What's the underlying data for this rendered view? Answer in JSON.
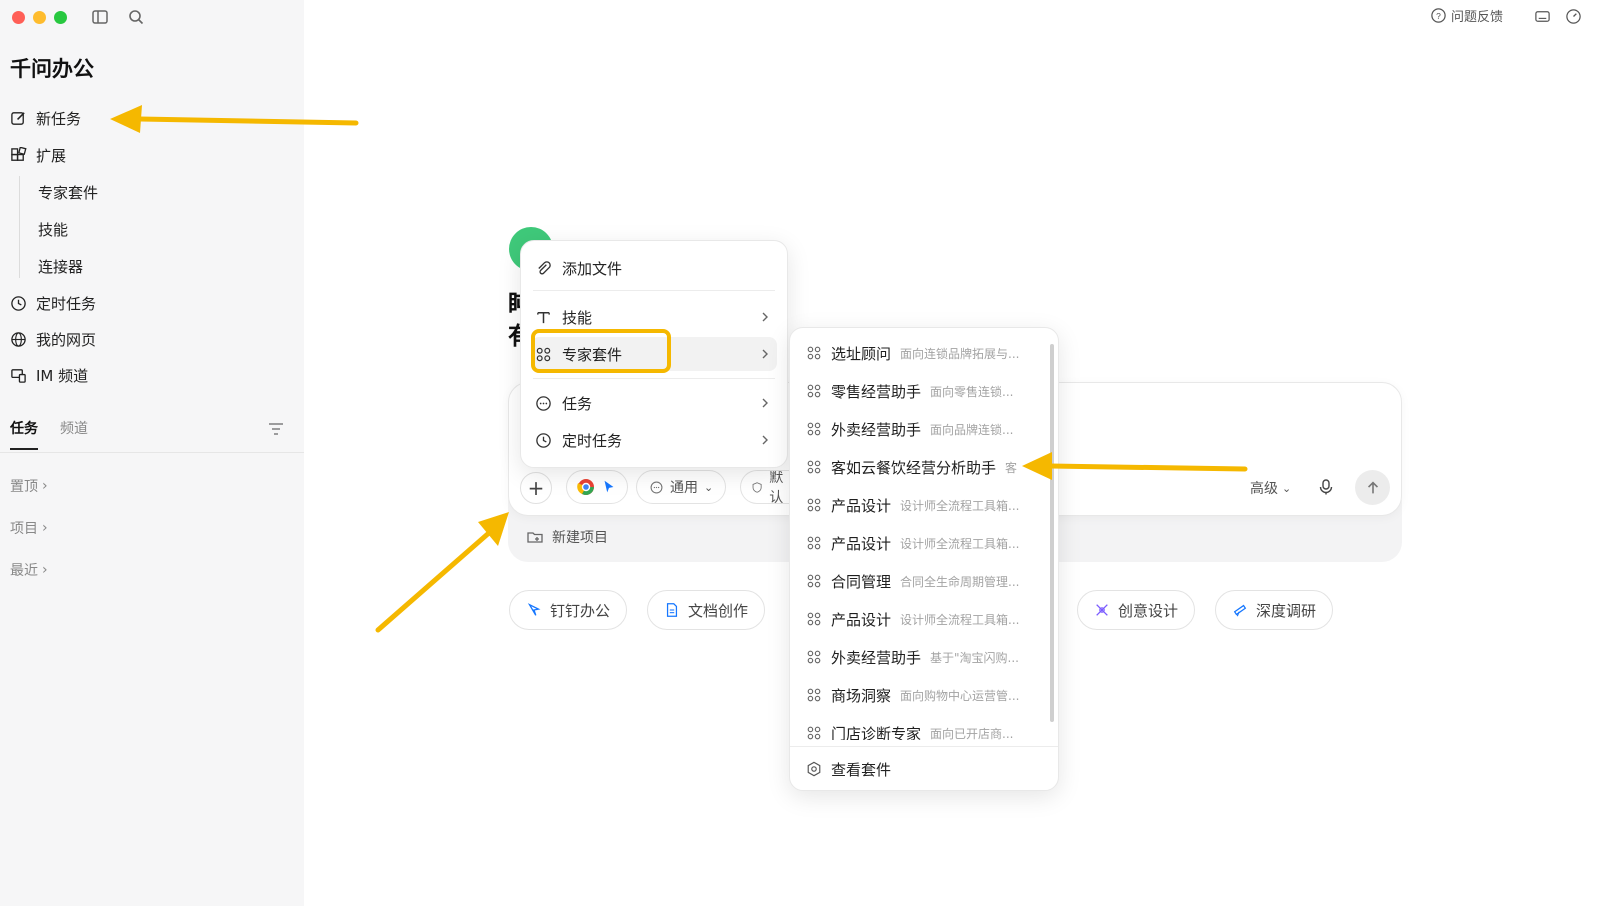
{
  "app": {
    "title": "千问办公"
  },
  "sidebar": {
    "new_task": "新任务",
    "extensions": "扩展",
    "ext_children": [
      "专家套件",
      "技能",
      "连接器"
    ],
    "scheduled": "定时任务",
    "webpages": "我的网页",
    "im_channel": "IM 频道",
    "tabs": [
      "任务",
      "频道"
    ],
    "groups": [
      "置顶",
      "项目",
      "最近"
    ]
  },
  "topbar": {
    "feedback": "问题反馈"
  },
  "composer": {
    "greeting_partial": [
      "盹",
      "有"
    ],
    "mode_general": "通用",
    "default_partial": "默认",
    "advanced": "高级",
    "new_project": "新建项目"
  },
  "chips": {
    "dingtalk": "钉钉办公",
    "doc": "文档创作",
    "creative": "创意设计",
    "research": "深度调研"
  },
  "menu_main": {
    "add_file": "添加文件",
    "skills": "技能",
    "expert_kit": "专家套件",
    "tasks": "任务",
    "scheduled": "定时任务"
  },
  "menu_kits": {
    "items": [
      {
        "name": "选址顾问",
        "desc": "面向连锁品牌拓展与..."
      },
      {
        "name": "零售经营助手",
        "desc": "面向零售连锁..."
      },
      {
        "name": "外卖经营助手",
        "desc": "面向品牌连锁..."
      },
      {
        "name": "客如云餐饮经营分析助手",
        "desc": "客"
      },
      {
        "name": "产品设计",
        "desc": "设计师全流程工具箱..."
      },
      {
        "name": "产品设计",
        "desc": "设计师全流程工具箱..."
      },
      {
        "name": "合同管理",
        "desc": "合同全生命周期管理..."
      },
      {
        "name": "产品设计",
        "desc": "设计师全流程工具箱..."
      },
      {
        "name": "外卖经营助手",
        "desc": "基于\"淘宝闪购..."
      },
      {
        "name": "商场洞察",
        "desc": "面向购物中心运营管..."
      },
      {
        "name": "门店诊断专家",
        "desc": "面向已开店商..."
      }
    ],
    "footer": "查看套件"
  },
  "colors": {
    "accent_highlight": "#f5b800",
    "avatar": "#3fc97a"
  }
}
